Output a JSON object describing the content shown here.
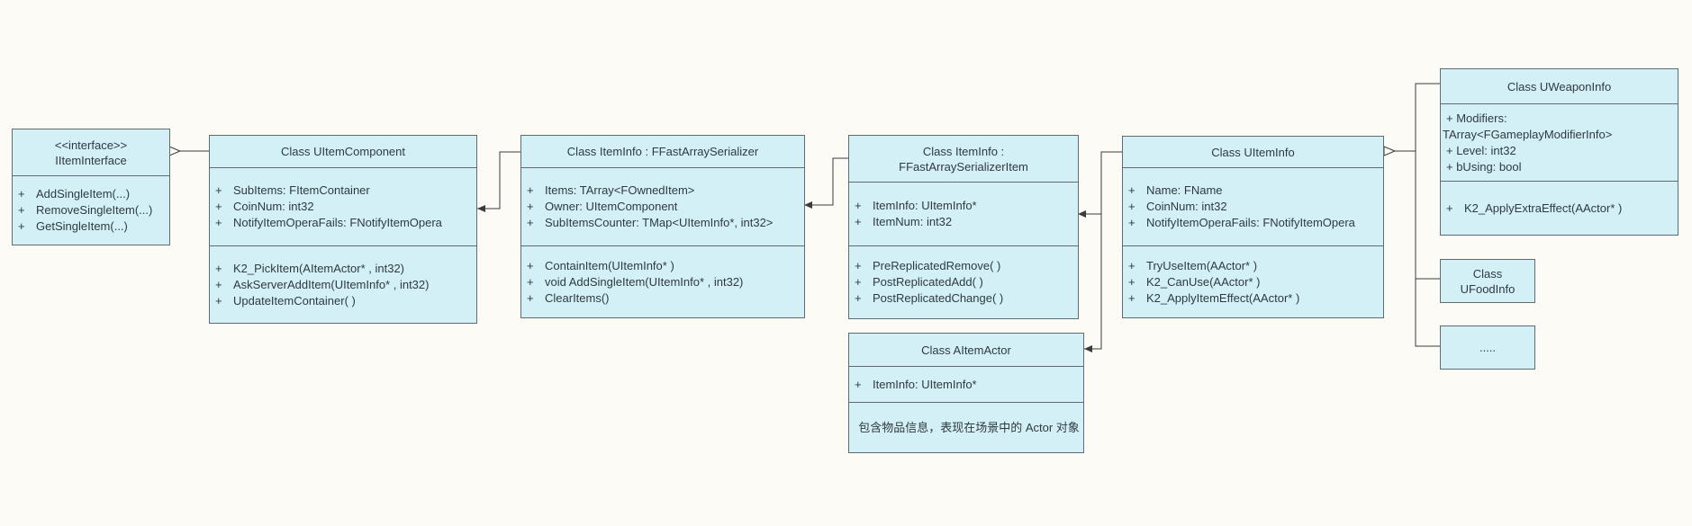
{
  "iface": {
    "stereotype": "<<interface>>",
    "name": "IItemInterface",
    "methods": [
      "+",
      "AddSingleItem(...)",
      "RemoveSingleItem(...)",
      "GetSingleItem(...)"
    ]
  },
  "comp": {
    "title": "Class UItemComponent",
    "attrs": [
      "SubItems: FItemContainer",
      "CoinNum: int32",
      "NotifyItemOperaFails: FNotifyItemOpera"
    ],
    "methods": [
      "K2_PickItem(AItemActor* , int32)",
      "AskServerAddItem(UItemInfo* , int32)",
      "UpdateItemContainer( )"
    ]
  },
  "serializer": {
    "title": "Class ItemInfo : FFastArraySerializer",
    "attrs": [
      "Items: TArray<FOwnedItem>",
      "Owner: UItemComponent",
      "SubItemsCounter: TMap<UItemInfo*, int32>"
    ],
    "methods": [
      "ContainItem(UItemInfo* )",
      "void AddSingleItem(UItemInfo* , int32)",
      "ClearItems()"
    ]
  },
  "serItem": {
    "title_line1": "Class ItemInfo :",
    "title_line2": "FFastArraySerializerItem",
    "attrs": [
      "ItemInfo: UItemInfo*",
      "ItemNum: int32"
    ],
    "methods": [
      "PreReplicatedRemove( )",
      "PostReplicatedAdd( )",
      "PostReplicatedChange( )"
    ]
  },
  "actor": {
    "title": "Class AItemActor",
    "attrs": [
      "ItemInfo: UItemInfo*"
    ],
    "note": "包含物品信息，表现在场景中的 Actor 对象"
  },
  "info": {
    "title": "Class UItemInfo",
    "attrs": [
      "Name: FName",
      "CoinNum: int32",
      "NotifyItemOperaFails: FNotifyItemOpera"
    ],
    "methods": [
      "TryUseItem(AActor* )",
      "K2_CanUse(AActor* )",
      "K2_ApplyItemEffect(AActor* )"
    ]
  },
  "weapon": {
    "title": "Class UWeaponInfo",
    "attr_lines": [
      "+   Modifiers:",
      "TArray<FGameplayModifierInfo>",
      "+   Level: int32",
      "+   bUsing: bool"
    ],
    "methods": [
      "K2_ApplyExtraEffect(AActor* )"
    ]
  },
  "food": {
    "title_line1": "Class",
    "title_line2": "UFoodInfo"
  },
  "more": {
    "title": "....."
  },
  "plus": "+",
  "colors": {
    "box_fill": "#d3f0f6",
    "border": "#5e6b70",
    "line": "#3b3b3b",
    "background": "#fdfbf6"
  }
}
